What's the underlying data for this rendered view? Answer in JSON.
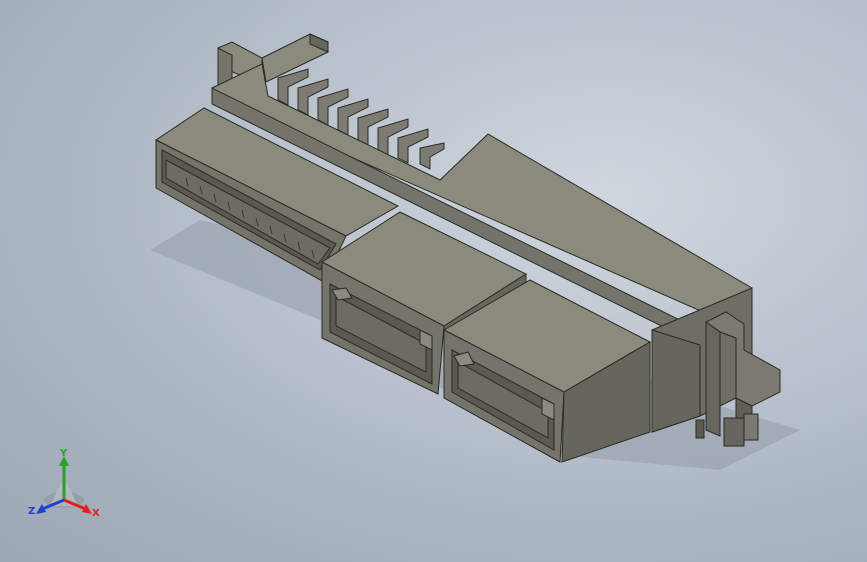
{
  "triad": {
    "x_label": "X",
    "y_label": "Y",
    "z_label": "Z",
    "x_color": "#e02020",
    "y_color": "#2aa02a",
    "z_color": "#2040d0"
  },
  "colors": {
    "top_face": "#8a8a7d",
    "front_face": "#74746a",
    "side_face": "#66665d",
    "dark_face": "#4f4f48",
    "edge": "#2a2a26",
    "shadow": "#8e97a3"
  },
  "icons": {
    "part": "connector-model-icon",
    "triad": "coordinate-triad-icon"
  }
}
